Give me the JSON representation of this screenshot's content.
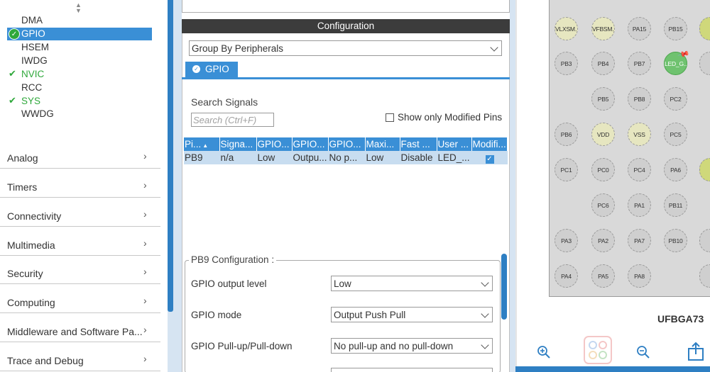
{
  "peripherals": [
    {
      "label": "DMA",
      "checked": false
    },
    {
      "label": "GPIO",
      "checked": true,
      "selected": true
    },
    {
      "label": "HSEM",
      "checked": false
    },
    {
      "label": "IWDG",
      "checked": false
    },
    {
      "label": "NVIC",
      "checked": true
    },
    {
      "label": "RCC",
      "checked": false
    },
    {
      "label": "SYS",
      "checked": true
    },
    {
      "label": "WWDG",
      "checked": false
    }
  ],
  "categories": [
    {
      "label": "Analog"
    },
    {
      "label": "Timers"
    },
    {
      "label": "Connectivity"
    },
    {
      "label": "Multimedia"
    },
    {
      "label": "Security"
    },
    {
      "label": "Computing"
    },
    {
      "label": "Middleware and Software Pa..."
    },
    {
      "label": "Trace and Debug"
    }
  ],
  "config": {
    "header": "Configuration",
    "group_by": "Group By Peripherals",
    "tab": "GPIO",
    "search_label": "Search Signals",
    "search_placeholder": "Search (Ctrl+F)",
    "show_modified": "Show only Modified Pins",
    "table": {
      "headers": [
        "Pi...",
        "Signa...",
        "GPIO...",
        "GPIO...",
        "GPIO...",
        "Maxi...",
        "Fast ...",
        "User ...",
        "Modifi..."
      ],
      "row": [
        "PB9",
        "n/a",
        "Low",
        "Outpu...",
        "No p...",
        "Low",
        "Disable",
        "LED_..."
      ]
    },
    "pin_config": {
      "title": "PB9 Configuration :",
      "fields": [
        {
          "label": "GPIO output level",
          "value": "Low"
        },
        {
          "label": "GPIO mode",
          "value": "Output Push Pull"
        },
        {
          "label": "GPIO Pull-up/Pull-down",
          "value": "No pull-up and no pull-down"
        }
      ]
    }
  },
  "pinout": {
    "package": "UFBGA73",
    "pins": [
      {
        "label": "VLXSM...",
        "color": "yellow"
      },
      {
        "label": "VFBSM...",
        "color": "yellow"
      },
      {
        "label": "PA15",
        "color": "gray"
      },
      {
        "label": "PB15",
        "color": "gray"
      },
      {
        "label": "PB3",
        "color": "gray"
      },
      {
        "label": "PB4",
        "color": "gray"
      },
      {
        "label": "PB7",
        "color": "gray"
      },
      {
        "label": "LED_G...",
        "color": "green"
      },
      {
        "label": "PB5",
        "color": "gray"
      },
      {
        "label": "PB8",
        "color": "gray"
      },
      {
        "label": "PC2",
        "color": "gray"
      },
      {
        "label": "PB6",
        "color": "gray"
      },
      {
        "label": "VDD",
        "color": "yellow"
      },
      {
        "label": "VSS",
        "color": "yellow"
      },
      {
        "label": "PC5",
        "color": "gray"
      },
      {
        "label": "PC1",
        "color": "gray"
      },
      {
        "label": "PC0",
        "color": "gray"
      },
      {
        "label": "PC4",
        "color": "gray"
      },
      {
        "label": "PA6",
        "color": "gray"
      },
      {
        "label": "PC6",
        "color": "gray"
      },
      {
        "label": "PA1",
        "color": "gray"
      },
      {
        "label": "PB11",
        "color": "gray"
      },
      {
        "label": "PA3",
        "color": "gray"
      },
      {
        "label": "PA2",
        "color": "gray"
      },
      {
        "label": "PA7",
        "color": "gray"
      },
      {
        "label": "PB10",
        "color": "gray"
      },
      {
        "label": "PA4",
        "color": "gray"
      },
      {
        "label": "PA5",
        "color": "gray"
      },
      {
        "label": "PA8",
        "color": "gray"
      }
    ]
  },
  "colors": {
    "accent": "#3a8fd6",
    "enabled": "#2fa83b",
    "header_dark": "#3c3c3c"
  }
}
